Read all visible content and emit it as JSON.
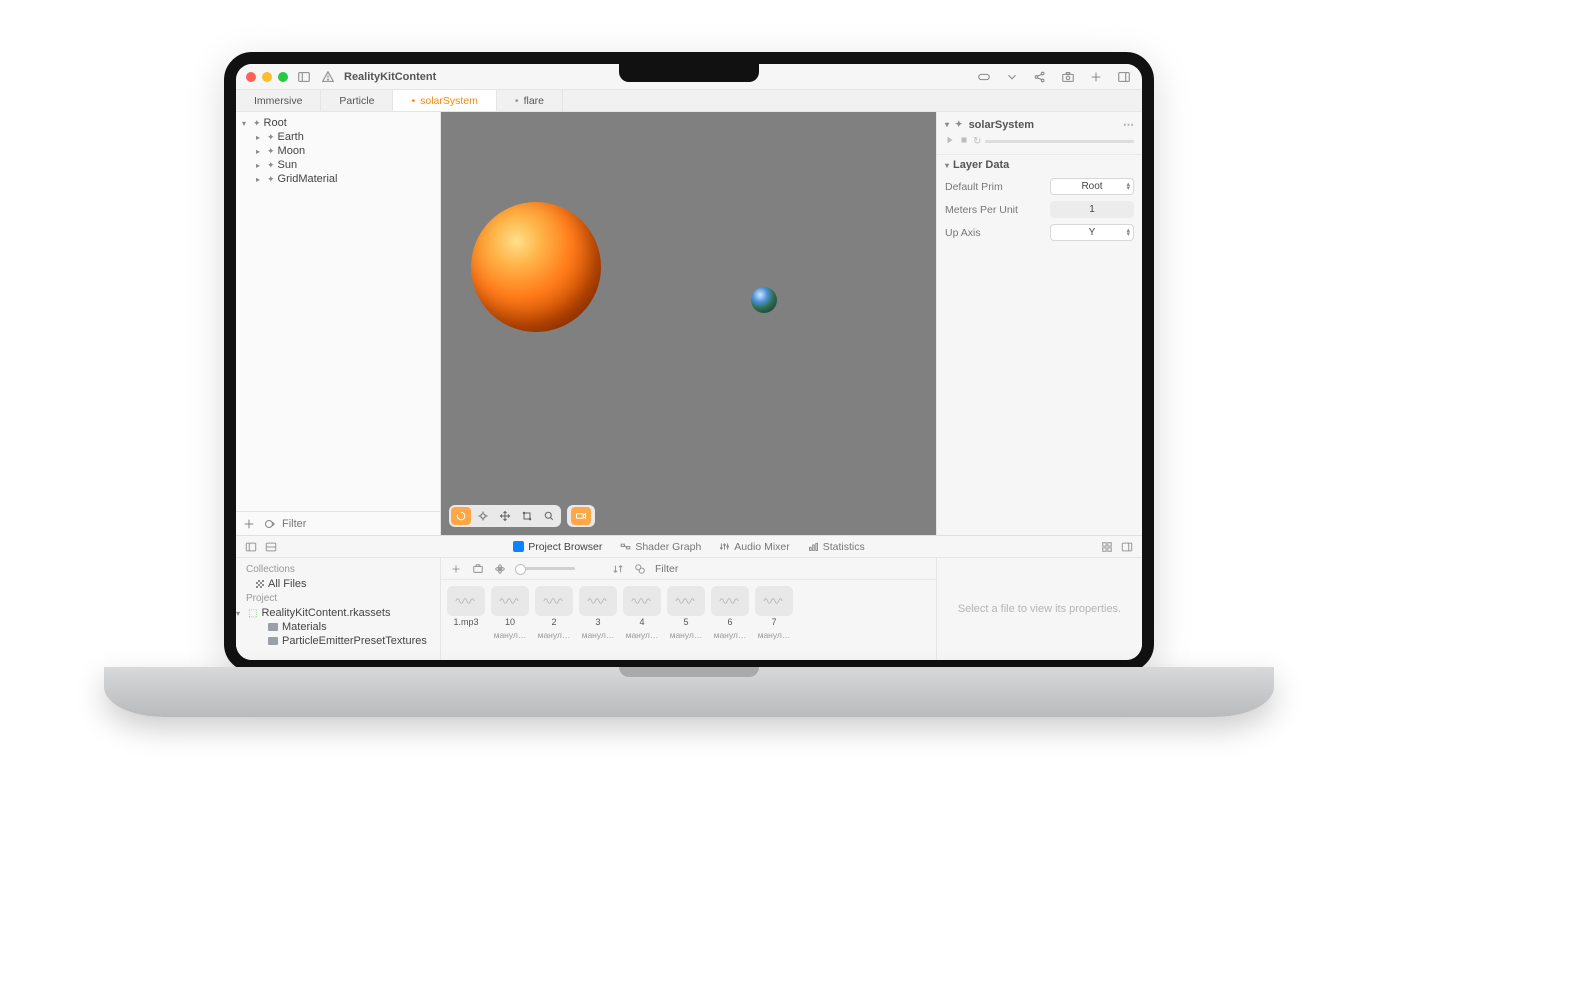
{
  "app": {
    "title": "RealityKitContent"
  },
  "tabs": [
    {
      "label": "Immersive",
      "modified": false,
      "active": false
    },
    {
      "label": "Particle",
      "modified": false,
      "active": false
    },
    {
      "label": "solarSystem",
      "modified": true,
      "active": true
    },
    {
      "label": "flare",
      "modified": true,
      "active": false
    }
  ],
  "scene_tree": {
    "root": "Root",
    "children": [
      {
        "name": "Earth"
      },
      {
        "name": "Moon"
      },
      {
        "name": "Sun"
      },
      {
        "name": "GridMaterial"
      }
    ]
  },
  "outline_footer": {
    "filter_placeholder": "Filter"
  },
  "inspector": {
    "entity": "solarSystem",
    "section_title": "Layer Data",
    "props": {
      "default_prim_label": "Default Prim",
      "default_prim_value": "Root",
      "mpu_label": "Meters Per Unit",
      "mpu_value": "1",
      "up_axis_label": "Up Axis",
      "up_axis_value": "Y"
    }
  },
  "bottom_tabs": {
    "project_browser": "Project Browser",
    "shader_graph": "Shader Graph",
    "audio_mixer": "Audio Mixer",
    "statistics": "Statistics"
  },
  "project_browser": {
    "collections_label": "Collections",
    "all_files": "All Files",
    "project_label": "Project",
    "asset_root": "RealityKitContent.rkassets",
    "folders": [
      "Materials",
      "ParticleEmitterPresetTextures"
    ],
    "toolbar": {
      "filter_placeholder": "Filter"
    },
    "files": [
      {
        "name": "1.mp3",
        "sub": ""
      },
      {
        "name": "10",
        "sub": "манул…"
      },
      {
        "name": "2",
        "sub": "манул…"
      },
      {
        "name": "3",
        "sub": "манул…"
      },
      {
        "name": "4",
        "sub": "манул…"
      },
      {
        "name": "5",
        "sub": "манул…"
      },
      {
        "name": "6",
        "sub": "манул…"
      },
      {
        "name": "7",
        "sub": "манул…"
      }
    ],
    "empty_right": "Select a file to view its properties."
  }
}
